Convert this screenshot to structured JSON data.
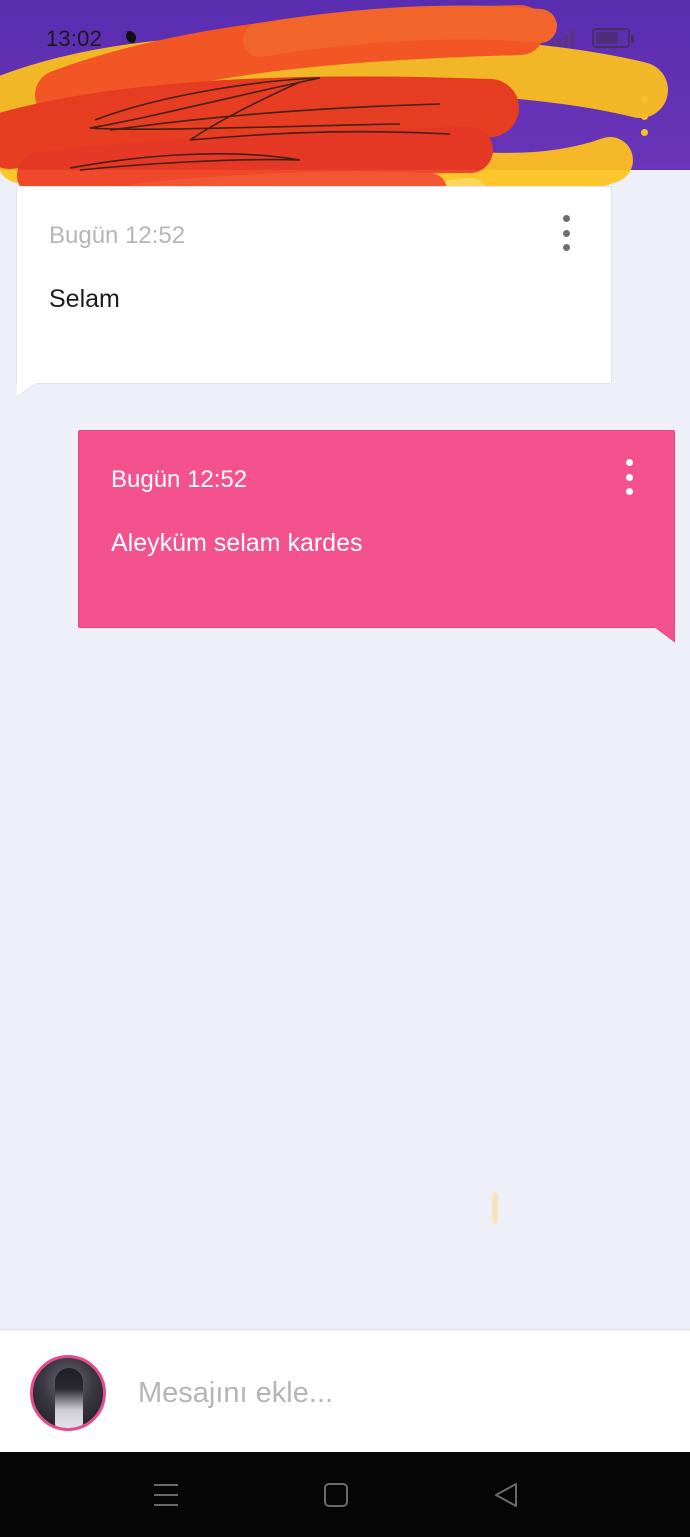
{
  "status_bar": {
    "time": "13:02"
  },
  "icons": {
    "moon": "moon-icon",
    "signal": "signal-icon",
    "battery": "battery-icon",
    "overflow": "more-vertical-icon",
    "nav_menu": "menu-icon",
    "nav_home": "home-square-icon",
    "nav_back": "back-triangle-icon"
  },
  "colors": {
    "header": "#5a2db0",
    "outgoing_bubble": "#f4528f",
    "incoming_bubble": "#ffffff",
    "background": "#eef0f8"
  },
  "messages": [
    {
      "direction": "incoming",
      "time": "Bugün 12:52",
      "text": "Selam"
    },
    {
      "direction": "outgoing",
      "time": "Bugün 12:52",
      "text": "Aleyküm selam kardes"
    }
  ],
  "composer": {
    "placeholder": "Mesajını ekle...",
    "value": ""
  }
}
